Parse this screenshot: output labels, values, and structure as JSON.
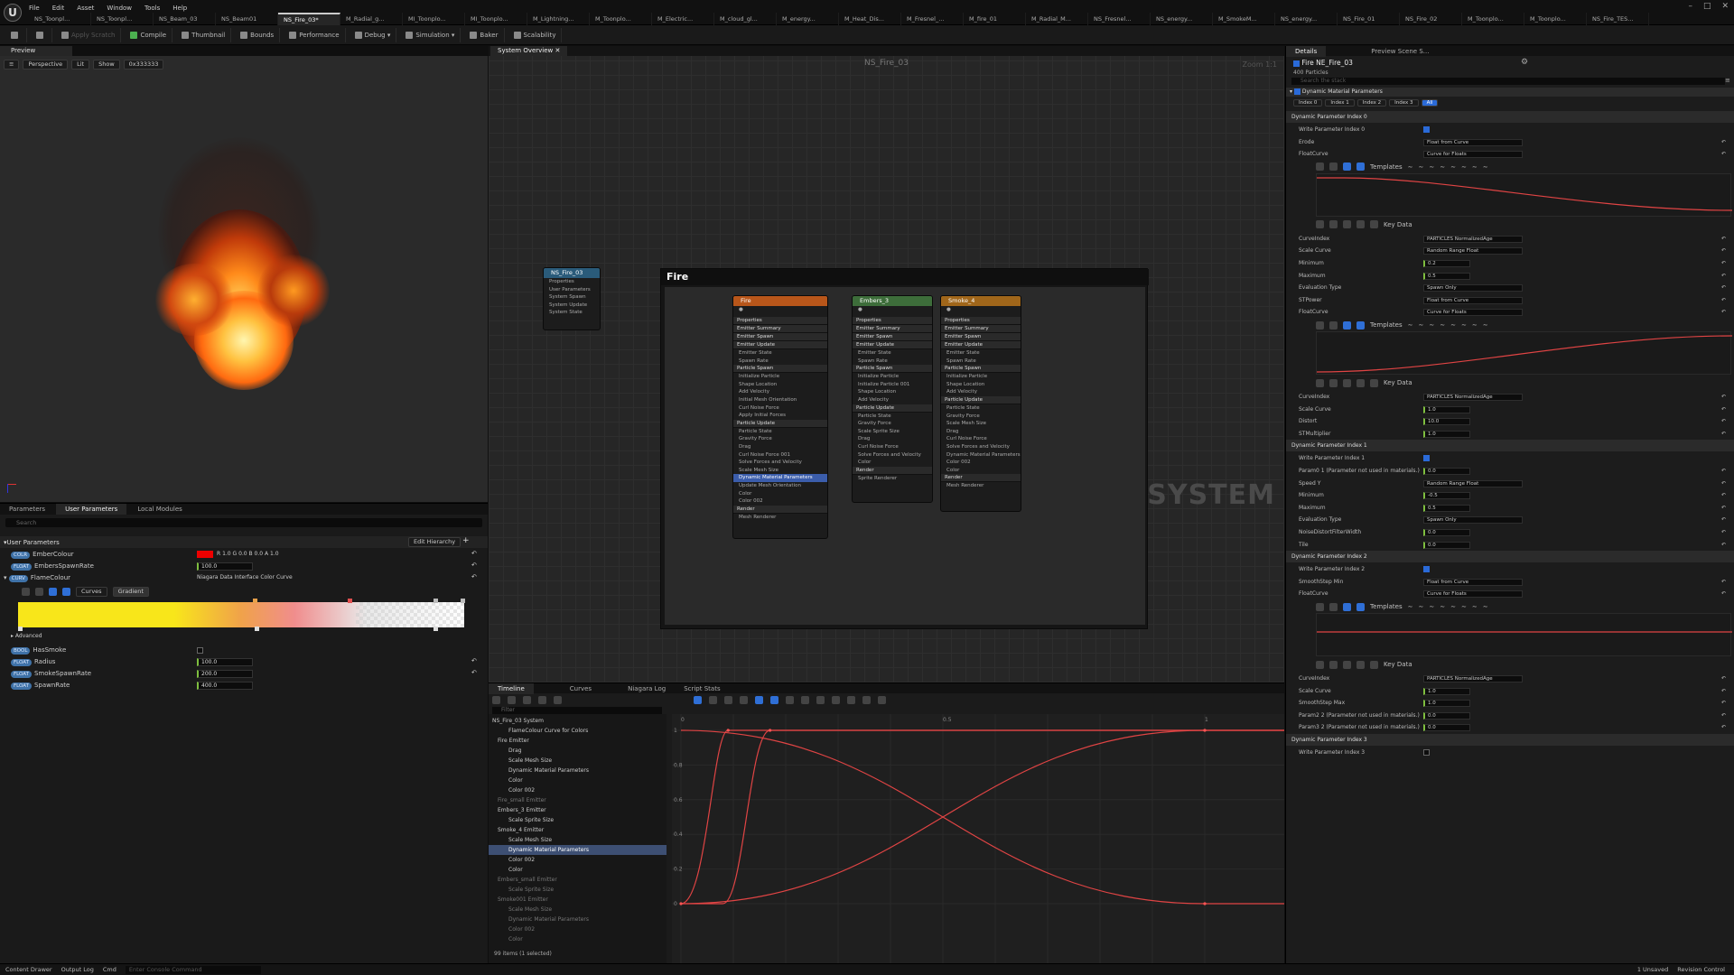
{
  "menu": [
    "File",
    "Edit",
    "Asset",
    "Window",
    "Tools",
    "Help"
  ],
  "doc_tabs": [
    "NS_Toonpl...",
    "NS_Toonpl...",
    "NS_Beam_03",
    "NS_Beam01",
    "NS_Fire_03*",
    "M_Radial_g...",
    "MI_Toonplo...",
    "MI_Toonplo...",
    "M_Lightning...",
    "M_Toonplo...",
    "M_Electric...",
    "M_cloud_gl...",
    "M_energy...",
    "M_Heat_Dis...",
    "M_Fresnel_...",
    "M_fire_01",
    "M_Radial_M...",
    "NS_Fresnel...",
    "NS_energy...",
    "M_SmokeM...",
    "NS_energy...",
    "NS_Fire_01",
    "NS_Fire_02",
    "M_Toonplo...",
    "M_Toonplo...",
    "NS_Fire_TES..."
  ],
  "toolbar": {
    "save": "",
    "apply": "Apply Scratch",
    "compile": "Compile",
    "thumbnail": "Thumbnail",
    "bounds": "Bounds",
    "performance": "Performance",
    "debug": "Debug",
    "simulation": "Simulation",
    "baker": "Baker",
    "scalability": "Scalability"
  },
  "preview": {
    "tab": "Preview",
    "perspective": "Perspective",
    "lit": "Lit",
    "show": "Show",
    "color": "0x333333"
  },
  "params": {
    "tabs": [
      "Parameters",
      "User Parameters",
      "Local Modules"
    ],
    "search": "Search",
    "section": "User Parameters",
    "edit_hierarchy": "Edit Hierarchy",
    "rows": [
      {
        "name": "EmberColour",
        "value": "R 1.0  G 0.0  B 0.0  A 1.0"
      },
      {
        "name": "EmbersSpawnRate",
        "value": "100.0"
      },
      {
        "name": "FlameColour",
        "value": "Niagara Data Interface Color Curve"
      }
    ],
    "curve_tabs": [
      "Curves",
      "Gradient"
    ],
    "advanced": "Advanced",
    "rows2": [
      {
        "name": "HasSmoke",
        "value": ""
      },
      {
        "name": "Radius",
        "value": "100.0"
      },
      {
        "name": "SmokeSpawnRate",
        "value": "200.0"
      },
      {
        "name": "SpawnRate",
        "value": "400.0"
      }
    ]
  },
  "graph": {
    "tab": "System Overview",
    "title": "NS_Fire_03",
    "zoom": "Zoom 1:1",
    "system_label": "SYSTEM",
    "group": "Fire",
    "sys_node": {
      "title": "NS_Fire_03",
      "items": [
        "Properties",
        "User Parameters",
        "System Spawn",
        "System Update",
        "System State"
      ]
    },
    "emitters": [
      {
        "title": "Fire",
        "items": [
          "Properties",
          "Emitter Summary",
          "Emitter Spawn",
          "Emitter Update",
          "Emitter State",
          "Spawn Rate",
          "Particle Spawn",
          "Initialize Particle",
          "Shape Location",
          "Add Velocity",
          "Initial Mesh Orientation",
          "Curl Noise Force",
          "Apply Initial Forces",
          "Particle Update",
          "Particle State",
          "Gravity Force",
          "Drag",
          "Curl Noise Force 001",
          "Solve Forces and Velocity",
          "Scale Mesh Size",
          "Dynamic Material Parameters",
          "Update Mesh Orientation",
          "Color",
          "Color 002",
          "Render",
          "Mesh Renderer"
        ]
      },
      {
        "title": "Embers_3",
        "items": [
          "Properties",
          "Emitter Summary",
          "Emitter Spawn",
          "Emitter Update",
          "Emitter State",
          "Spawn Rate",
          "Particle Spawn",
          "Initialize Particle",
          "Initialize Particle 001",
          "Shape Location",
          "Add Velocity",
          "Particle Update",
          "Particle State",
          "Gravity Force",
          "Scale Sprite Size",
          "Drag",
          "Curl Noise Force",
          "Solve Forces and Velocity",
          "Color",
          "Render",
          "Sprite Renderer"
        ]
      },
      {
        "title": "Smoke_4",
        "items": [
          "Properties",
          "Emitter Summary",
          "Emitter Spawn",
          "Emitter Update",
          "Emitter State",
          "Spawn Rate",
          "Particle Spawn",
          "Initialize Particle",
          "Shape Location",
          "Add Velocity",
          "Particle Update",
          "Particle State",
          "Gravity Force",
          "Scale Mesh Size",
          "Drag",
          "Curl Noise Force",
          "Solve Forces and Velocity",
          "Dynamic Material Parameters",
          "Color 002",
          "Color",
          "Render",
          "Mesh Renderer"
        ]
      }
    ]
  },
  "timeline": {
    "tabs": [
      "Timeline",
      "Curves",
      "Niagara Log",
      "Script Stats"
    ],
    "filter": "Filter",
    "tree": [
      "NS_Fire_03  System",
      "FlameColour  Curve for Colors",
      "Fire  Emitter",
      "Drag",
      "Scale Mesh Size",
      "Dynamic Material Parameters",
      "Color",
      "Color 002",
      "Fire_small  Emitter",
      "Embers_3  Emitter",
      "Scale Sprite Size",
      "Smoke_4  Emitter",
      "Scale Mesh Size",
      "Dynamic Material Parameters",
      "Color 002",
      "Color",
      "Embers_small  Emitter",
      "Scale Sprite Size",
      "Smoke001  Emitter",
      "Scale Mesh Size",
      "Dynamic Material Parameters",
      "Color 002",
      "Color"
    ],
    "count": "99 items (1 selected)",
    "ticks_x": [
      "0",
      "0.5",
      "1"
    ],
    "ticks_y": [
      "1",
      "0.8",
      "0.6",
      "0.4",
      "0.2",
      "0"
    ]
  },
  "details": {
    "tabs": [
      "Details",
      "Preview Scene S..."
    ],
    "title": "Fire NE_Fire_03",
    "subtitle": "400 Particles",
    "search": "Search the stack",
    "module": "Dynamic Material Parameters",
    "index_tabs": [
      "Index 0",
      "Index 1",
      "Index 2",
      "Index 3",
      "All"
    ],
    "rows": [
      {
        "label": "Dynamic Parameter Index 0",
        "sec": true
      },
      {
        "label": "Write Parameter Index 0",
        "chk": true
      },
      {
        "label": "Erode",
        "value": "Float from Curve"
      },
      {
        "label": "FloatCurve",
        "value": "Curve for Floats"
      },
      {
        "curve": 1
      },
      {
        "label": "CurveIndex",
        "value": "PARTICLES  NormalizedAge"
      },
      {
        "label": "Scale Curve",
        "value": "Random Range Float"
      },
      {
        "label": "Minimum",
        "value": "0.2"
      },
      {
        "label": "Maximum",
        "value": "0.5"
      },
      {
        "label": "Evaluation Type",
        "value": "Spawn Only"
      },
      {
        "label": "STPower",
        "value": "Float from Curve"
      },
      {
        "label": "FloatCurve",
        "value": "Curve for Floats"
      },
      {
        "curve": 2
      },
      {
        "label": "CurveIndex",
        "value": "PARTICLES  NormalizedAge"
      },
      {
        "label": "Scale Curve",
        "value": "1.0"
      },
      {
        "label": "Distort",
        "value": "10.0"
      },
      {
        "label": "STMultiplier",
        "value": "1.0"
      },
      {
        "label": "Dynamic Parameter Index 1",
        "sec": true
      },
      {
        "label": "Write Parameter Index 1",
        "chk": true
      },
      {
        "label": "Param0 1 (Parameter not used in materials.)",
        "value": "0.0"
      },
      {
        "label": "Speed Y",
        "value": "Random Range Float"
      },
      {
        "label": "Minimum",
        "value": "-0.5"
      },
      {
        "label": "Maximum",
        "value": "0.5"
      },
      {
        "label": "Evaluation Type",
        "value": "Spawn Only"
      },
      {
        "label": "NoiseDistortFilterWidth",
        "value": "0.0"
      },
      {
        "label": "Tile",
        "value": "0.0"
      },
      {
        "label": "Dynamic Parameter Index 2",
        "sec": true
      },
      {
        "label": "Write Parameter Index 2",
        "chk": true
      },
      {
        "label": "SmoothStep Min",
        "value": "Float from Curve"
      },
      {
        "label": "FloatCurve",
        "value": "Curve for Floats"
      },
      {
        "curve": 3
      },
      {
        "label": "CurveIndex",
        "value": "PARTICLES  NormalizedAge"
      },
      {
        "label": "Scale Curve",
        "value": "1.0"
      },
      {
        "label": "SmoothStep Max",
        "value": "1.0"
      },
      {
        "label": "Param2 2 (Parameter not used in materials.)",
        "value": "0.0"
      },
      {
        "label": "Param3 2 (Parameter not used in materials.)",
        "value": "0.0"
      },
      {
        "label": "Dynamic Parameter Index 3",
        "sec": true
      },
      {
        "label": "Write Parameter Index 3",
        "chk": false
      }
    ],
    "templates": "Templates",
    "key_data": "Key Data"
  },
  "status": {
    "content_drawer": "Content Drawer",
    "output_log": "Output Log",
    "cmd": "Cmd",
    "console": "Enter Console Command",
    "unsaved": "1 Unsaved",
    "revision": "Revision Control"
  }
}
